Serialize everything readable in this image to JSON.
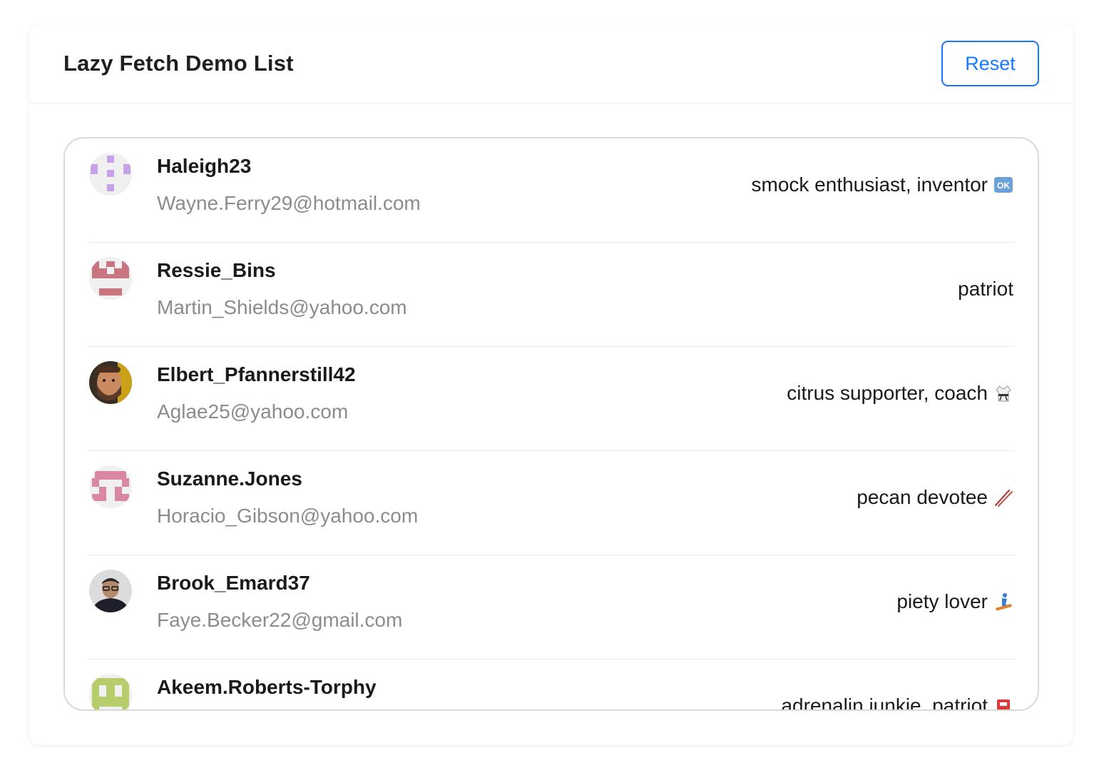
{
  "header": {
    "title": "Lazy Fetch Demo List",
    "reset_label": "Reset"
  },
  "users": [
    {
      "username": "Haleigh23",
      "email": "Wayne.Ferry29@hotmail.com",
      "description": "smock enthusiast, inventor",
      "emoji": "ok-button-emoji",
      "avatar": "identicon-purple",
      "avatar_color": "#c8a2e8"
    },
    {
      "username": "Ressie_Bins",
      "email": "Martin_Shields@yahoo.com",
      "description": "patriot",
      "emoji": "",
      "avatar": "identicon-red",
      "avatar_color": "#c97580"
    },
    {
      "username": "Elbert_Pfannerstill42",
      "email": "Aglae25@yahoo.com",
      "description": "citrus supporter, coach",
      "emoji": "martial-arts-uniform-emoji",
      "avatar": "photo-man-bearded",
      "avatar_color": "#6b4a34"
    },
    {
      "username": "Suzanne.Jones",
      "email": "Horacio_Gibson@yahoo.com",
      "description": "pecan devotee",
      "emoji": "chopsticks-emoji",
      "avatar": "identicon-pink",
      "avatar_color": "#d987a3"
    },
    {
      "username": "Brook_Emard37",
      "email": "Faye.Becker22@gmail.com",
      "description": "piety lover",
      "emoji": "snowboarder-emoji",
      "avatar": "photo-man-glasses",
      "avatar_color": "#2b2b2b"
    },
    {
      "username": "Akeem.Roberts-Torphy",
      "email": "",
      "description": "adrenalin junkie, patriot",
      "emoji": "red-emoji",
      "avatar": "identicon-green",
      "avatar_color": "#b7cc6b"
    }
  ]
}
